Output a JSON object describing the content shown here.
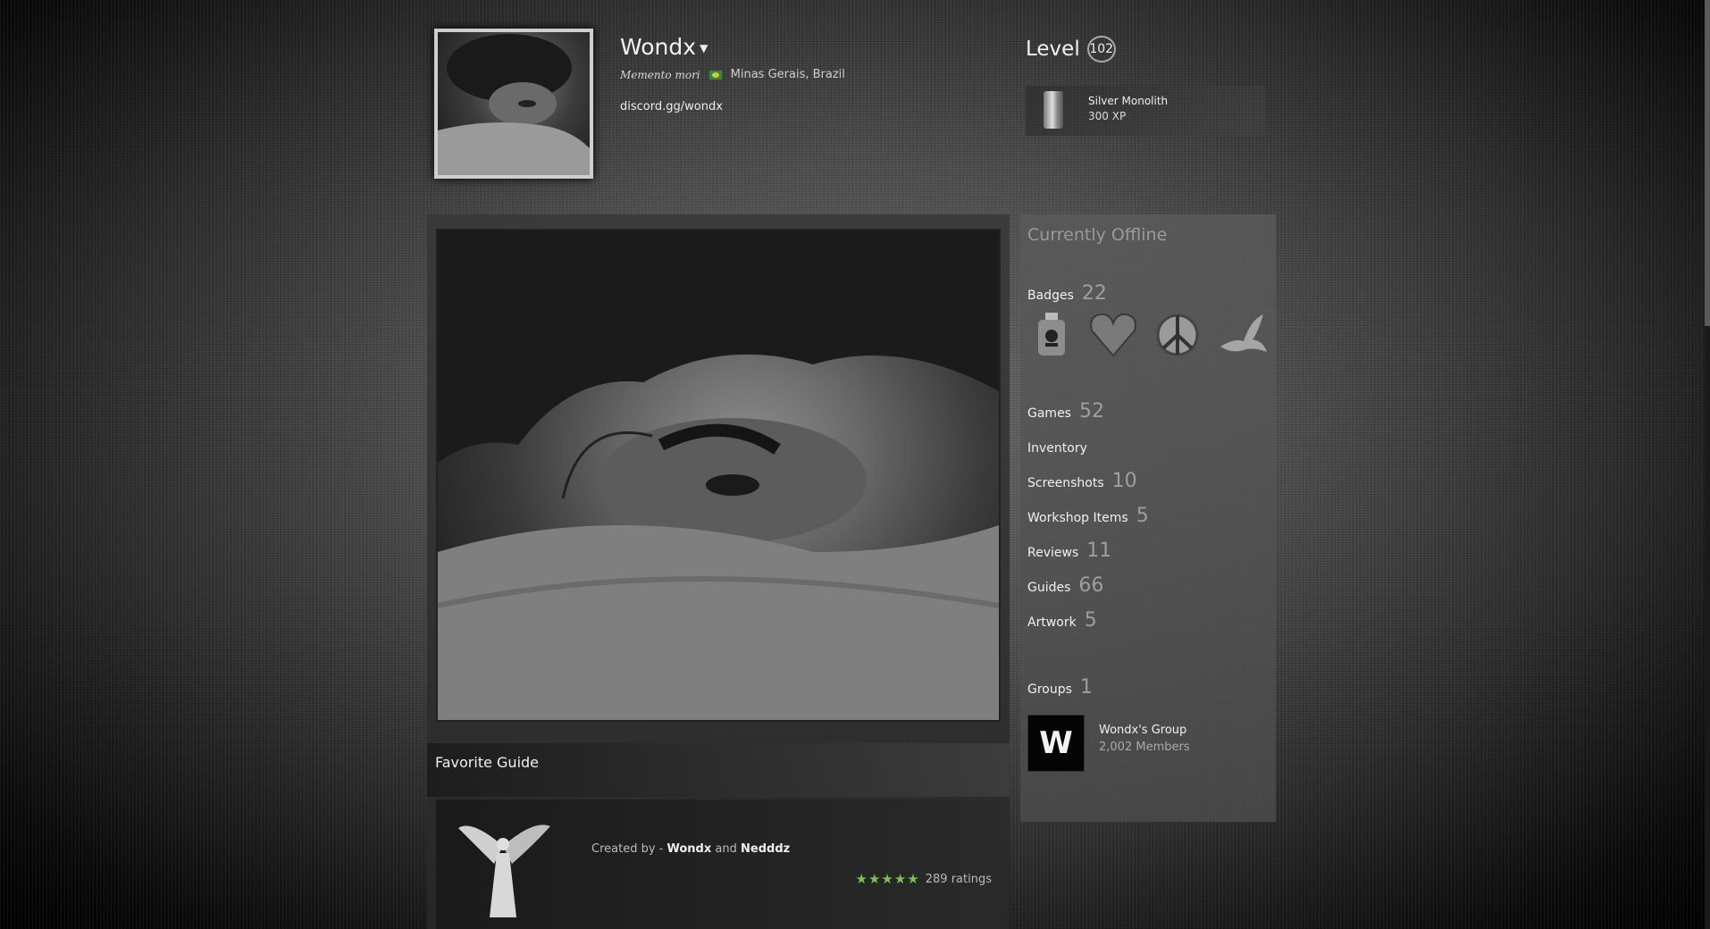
{
  "profile": {
    "name": "Wondx",
    "motto": "Memento mori",
    "location": "Minas Gerais, Brazil",
    "link": "discord.gg/wondx",
    "level_label": "Level",
    "level": "102",
    "featured_badge": {
      "name": "Silver Monolith",
      "xp": "300 XP"
    }
  },
  "status": "Currently Offline",
  "stats": {
    "badges": {
      "label": "Badges",
      "count": "22"
    },
    "games": {
      "label": "Games",
      "count": "52"
    },
    "inventory": {
      "label": "Inventory"
    },
    "screenshots": {
      "label": "Screenshots",
      "count": "10"
    },
    "workshop": {
      "label": "Workshop Items",
      "count": "5"
    },
    "reviews": {
      "label": "Reviews",
      "count": "11"
    },
    "guides": {
      "label": "Guides",
      "count": "66"
    },
    "artwork": {
      "label": "Artwork",
      "count": "5"
    },
    "groups": {
      "label": "Groups",
      "count": "1"
    }
  },
  "badge_icons": [
    "poison-bottle-icon",
    "heart-icon",
    "peace-symbol-icon",
    "dove-icon"
  ],
  "group": {
    "initial": "W",
    "name": "Wondx's Group",
    "members": "2,002 Members"
  },
  "favorite_guide": {
    "title": "Favorite Guide",
    "created_by": "Created by -",
    "author1": "Wondx",
    "and": "and",
    "author2": "Nedddz",
    "stars": "★★★★★",
    "ratings": "289 ratings"
  },
  "colors": {
    "star": "#7cc24a"
  }
}
